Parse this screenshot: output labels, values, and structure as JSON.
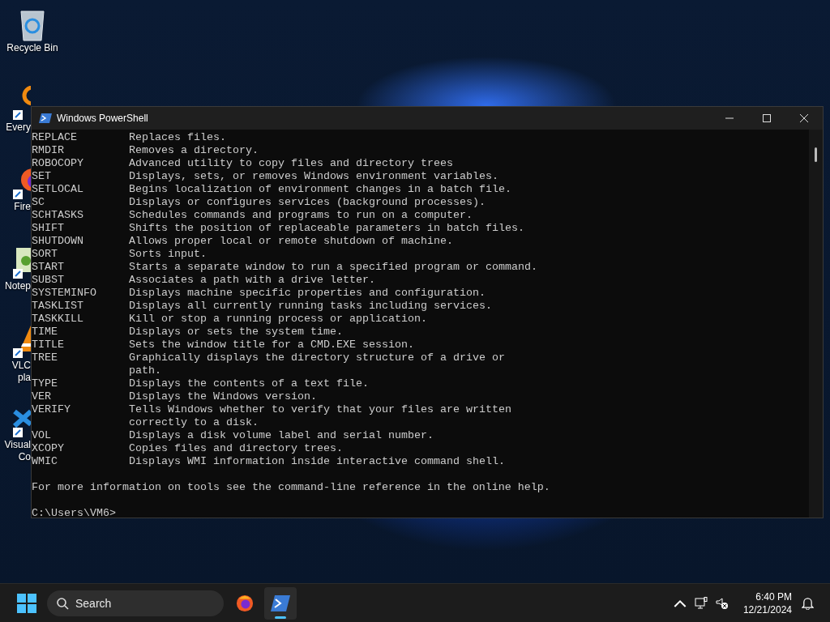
{
  "desktop_icons": [
    {
      "kind": "recycle",
      "label": [
        "Recycle Bin"
      ]
    },
    {
      "kind": "everything",
      "label": [
        "Every"
      ]
    },
    {
      "kind": "firefox",
      "label": [
        "Fire"
      ]
    },
    {
      "kind": "notepad",
      "label": [
        "Notep"
      ]
    },
    {
      "kind": "vlc",
      "label": [
        "VLC",
        "pla"
      ]
    },
    {
      "kind": "vscode",
      "label": [
        "Visual",
        "Co"
      ]
    }
  ],
  "window": {
    "title": "Windows PowerShell"
  },
  "console": {
    "lines": [
      {
        "kind": "command",
        "command": "REPLACE",
        "description": "Replaces files."
      },
      {
        "kind": "command",
        "command": "RMDIR",
        "description": "Removes a directory."
      },
      {
        "kind": "command",
        "command": "ROBOCOPY",
        "description": "Advanced utility to copy files and directory trees"
      },
      {
        "kind": "command",
        "command": "SET",
        "description": "Displays, sets, or removes Windows environment variables."
      },
      {
        "kind": "command",
        "command": "SETLOCAL",
        "description": "Begins localization of environment changes in a batch file."
      },
      {
        "kind": "command",
        "command": "SC",
        "description": "Displays or configures services (background processes)."
      },
      {
        "kind": "command",
        "command": "SCHTASKS",
        "description": "Schedules commands and programs to run on a computer."
      },
      {
        "kind": "command",
        "command": "SHIFT",
        "description": "Shifts the position of replaceable parameters in batch files."
      },
      {
        "kind": "command",
        "command": "SHUTDOWN",
        "description": "Allows proper local or remote shutdown of machine."
      },
      {
        "kind": "command",
        "command": "SORT",
        "description": "Sorts input."
      },
      {
        "kind": "command",
        "command": "START",
        "description": "Starts a separate window to run a specified program or command."
      },
      {
        "kind": "command",
        "command": "SUBST",
        "description": "Associates a path with a drive letter."
      },
      {
        "kind": "command",
        "command": "SYSTEMINFO",
        "description": "Displays machine specific properties and configuration."
      },
      {
        "kind": "command",
        "command": "TASKLIST",
        "description": "Displays all currently running tasks including services."
      },
      {
        "kind": "command",
        "command": "TASKKILL",
        "description": "Kill or stop a running process or application."
      },
      {
        "kind": "command",
        "command": "TIME",
        "description": "Displays or sets the system time."
      },
      {
        "kind": "command",
        "command": "TITLE",
        "description": "Sets the window title for a CMD.EXE session."
      },
      {
        "kind": "command",
        "command": "TREE",
        "description": "Graphically displays the directory structure of a drive or"
      },
      {
        "kind": "continuation",
        "description": "path."
      },
      {
        "kind": "command",
        "command": "TYPE",
        "description": "Displays the contents of a text file."
      },
      {
        "kind": "command",
        "command": "VER",
        "description": "Displays the Windows version."
      },
      {
        "kind": "command",
        "command": "VERIFY",
        "description": "Tells Windows whether to verify that your files are written"
      },
      {
        "kind": "continuation",
        "description": "correctly to a disk."
      },
      {
        "kind": "command",
        "command": "VOL",
        "description": "Displays a disk volume label and serial number."
      },
      {
        "kind": "command",
        "command": "XCOPY",
        "description": "Copies files and directory trees."
      },
      {
        "kind": "command",
        "command": "WMIC",
        "description": "Displays WMI information inside interactive command shell."
      },
      {
        "kind": "blank"
      },
      {
        "kind": "text",
        "text": "For more information on tools see the command-line reference in the online help."
      },
      {
        "kind": "blank"
      },
      {
        "kind": "prompt",
        "text": "C:\\Users\\VM6>"
      }
    ]
  },
  "taskbar": {
    "search": {
      "placeholder": "Search"
    },
    "apps": [
      {
        "kind": "firefox",
        "selected": false
      },
      {
        "kind": "powershell",
        "selected": true
      }
    ],
    "tray": {
      "time": "6:40 PM",
      "date": "12/21/2024"
    }
  }
}
